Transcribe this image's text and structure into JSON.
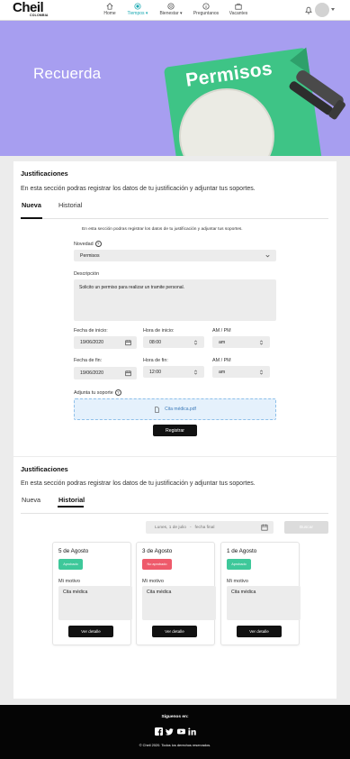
{
  "brand": {
    "name": "Cheil",
    "country": "COLOMBIA"
  },
  "nav": {
    "items": [
      {
        "label": "Home",
        "icon": "home-icon"
      },
      {
        "label": "Tiempos ▾",
        "icon": "clock-icon"
      },
      {
        "label": "Bienestar ▾",
        "icon": "wellness-icon"
      },
      {
        "label": "Preguntanos",
        "icon": "info-icon"
      },
      {
        "label": "Vacantes",
        "icon": "briefcase-icon"
      }
    ],
    "active_color": "#1aa9b2"
  },
  "hero": {
    "title": "Recuerda",
    "card_text": "Permisos",
    "bg_color": "#a79ef0",
    "card_color": "#3ec486"
  },
  "section1": {
    "title": "Justificaciones",
    "description": "En esta sección podras registrar  los datos de tu justificación y adjuntar tus soportes.",
    "tabs": [
      "Nueva",
      "Historial"
    ],
    "form": {
      "intro": "En esta sección podras registrar  los datos de tu justificación y adjuntar tus soportes.",
      "novedad_label": "Novedad",
      "novedad_value": "Permisos",
      "descripcion_label": "Descripción",
      "descripcion_value": "Solicito un permiso para realizar un tramite personal.",
      "fecha_inicio_label": "Fecha de inicio:",
      "fecha_inicio_value": "19/06/2020",
      "hora_inicio_label": "Hora de inicio:",
      "hora_inicio_value": "08:00",
      "ampm_label": "AM / PM",
      "ampm_inicio_value": "am",
      "fecha_fin_label": "Fecha de fin:",
      "fecha_fin_value": "19/06/2020",
      "hora_fin_label": "Hora de fin:",
      "hora_fin_value": "12:00",
      "ampm_fin_value": "am",
      "soporte_label": "Adjunta tu soporte",
      "soporte_file": "Cita médica.pdf",
      "submit_label": "Registrar"
    }
  },
  "section2": {
    "title": "Justificaciones",
    "description": "En esta sección podras registrar  los datos de tu justificación y adjuntar tus soportes.",
    "tabs": [
      "Nueva",
      "Historial"
    ],
    "filter": {
      "start_date": "Lunes, 1 de julio",
      "separator": "-",
      "end_placeholder": "fecha final",
      "search_label": "Buscar"
    },
    "motivo_label": "Mi motivo",
    "detail_label": "Ver detalle",
    "cards": [
      {
        "date": "5 de Agosto",
        "status": "Aprobado",
        "status_color": "#3ec89a",
        "motivo": "Cita médica"
      },
      {
        "date": "3 de Agosto",
        "status": "No aprobado",
        "status_color": "#ee5a6b",
        "motivo": "Cita médica"
      },
      {
        "date": "1 de Agosto",
        "status": "Aprobado",
        "status_color": "#3ec89a",
        "motivo": "Cita médica"
      }
    ]
  },
  "footer": {
    "follow": "Síguenos en:",
    "socials": [
      "facebook-icon",
      "twitter-icon",
      "youtube-icon",
      "linkedin-icon"
    ],
    "copyright": "© Cheil 2020. Todos los derechos reservados."
  }
}
